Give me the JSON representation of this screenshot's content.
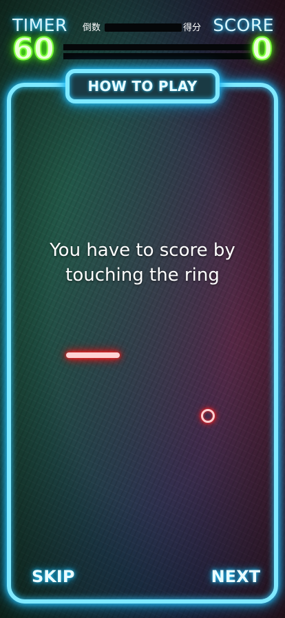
{
  "hud": {
    "timer_label": "TIMER",
    "timer_sub": "倒数",
    "timer_value": "60",
    "score_label": "SCORE",
    "score_sub": "得分",
    "score_value": "0"
  },
  "panel": {
    "title": "HOW TO PLAY",
    "instruction_line1": "You have to score by",
    "instruction_line2": "touching the ring"
  },
  "nav": {
    "skip_label": "SKIP",
    "next_label": "NEXT"
  },
  "colors": {
    "neon_blue": "#29c8ff",
    "neon_green": "#5dff20",
    "neon_red": "#ff1a1a"
  },
  "icons": {
    "paddle": "red-neon-paddle",
    "ring": "red-neon-ring"
  }
}
